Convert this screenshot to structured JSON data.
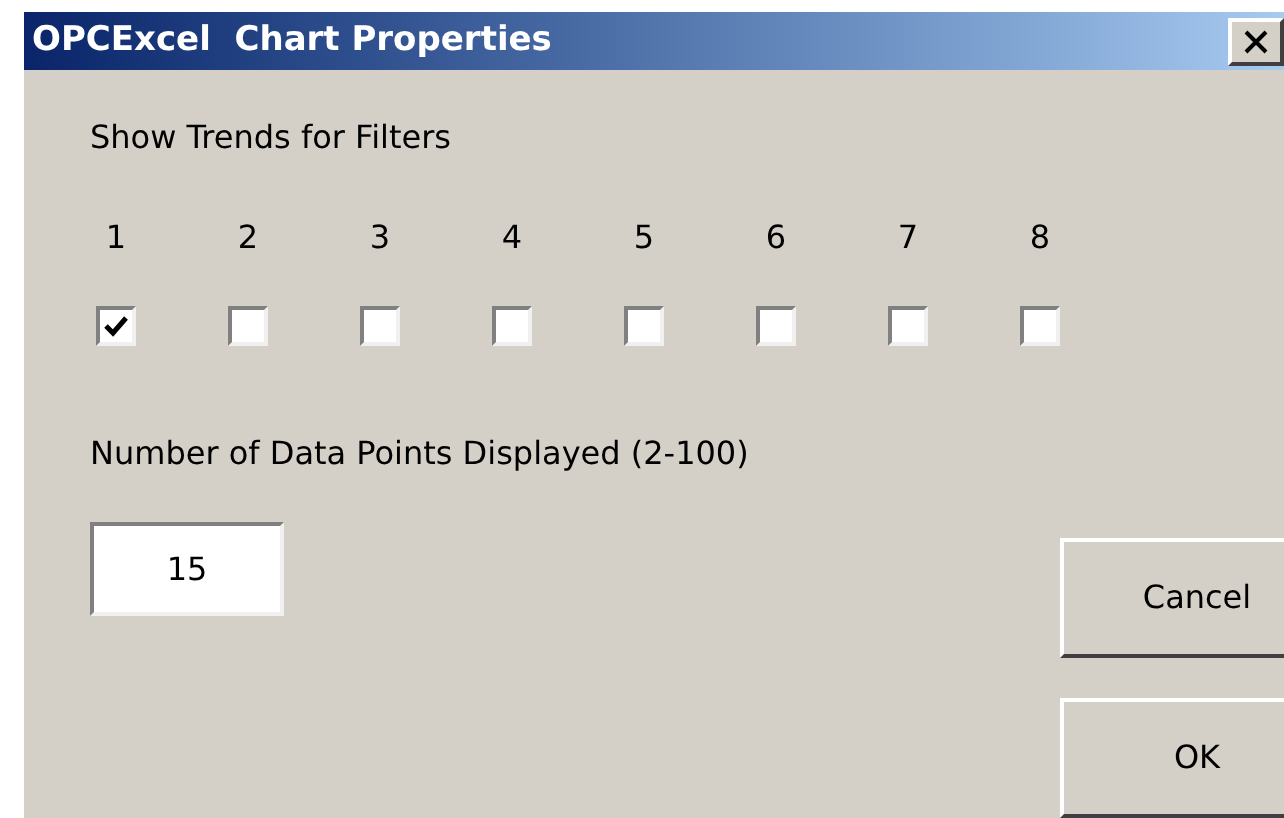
{
  "window": {
    "title": "OPCExcel  Chart Properties"
  },
  "filters_label": "Show Trends for Filters",
  "filters": [
    {
      "label": "1",
      "checked": true
    },
    {
      "label": "2",
      "checked": false
    },
    {
      "label": "3",
      "checked": false
    },
    {
      "label": "4",
      "checked": false
    },
    {
      "label": "5",
      "checked": false
    },
    {
      "label": "6",
      "checked": false
    },
    {
      "label": "7",
      "checked": false
    },
    {
      "label": "8",
      "checked": false
    }
  ],
  "data_points": {
    "label": "Number of Data Points Displayed (2-100)",
    "value": "15"
  },
  "buttons": [
    "Cancel",
    "OK"
  ]
}
